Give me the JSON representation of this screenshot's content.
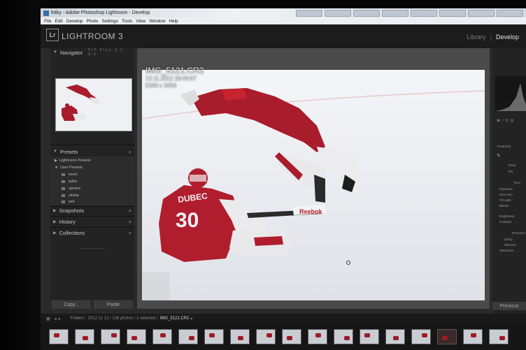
{
  "window": {
    "title": "fotky - Adobe Photoshop Lightroom - Develop"
  },
  "menu": [
    "File",
    "Edit",
    "Develop",
    "Photo",
    "Settings",
    "Tools",
    "View",
    "Window",
    "Help"
  ],
  "header": {
    "logo": "Lr",
    "app_name": "LIGHTROOM 3",
    "modules": [
      "Library",
      "Develop"
    ]
  },
  "left_panel": {
    "navigator": {
      "label": "Navigator",
      "options": "FIT FILL 1:1 3:1"
    },
    "presets": {
      "label": "Presets",
      "groups": [
        "Lightroom Presets",
        "User Presets"
      ],
      "items": [
        "new1",
        "tabla",
        "uprava",
        "vineta",
        "wol"
      ]
    },
    "snapshots": "Snapshots",
    "history": "History",
    "collections": "Collections",
    "copy_label": "Copy...",
    "paste_label": "Paste"
  },
  "photo": {
    "filename": "IMG_5121.CR2",
    "datetime": "12.11.2012 20:40:07",
    "dimensions": "5184 x 3456",
    "jersey_number": "30",
    "jersey_name": "DUBEC",
    "brand": "Reebok"
  },
  "right_panel": {
    "treatment": "Treatment",
    "tone_items": [
      "Temp",
      "Tint",
      "Tone",
      "Exposure",
      "Recovery",
      "Fill Light",
      "Blacks",
      "Brightness",
      "Contrast",
      "Presence",
      "Clarity",
      "Vibrance",
      "Saturation"
    ],
    "previous_label": "Previous"
  },
  "filmstrip": {
    "folder": "Folders : 2012 11 12 / 126 photos / 1 selected /",
    "selected_file": "IMG_5121.CR2",
    "thumb_count": 18
  },
  "colors": {
    "jersey_red": "#b01e2e",
    "ice": "#eceef2",
    "panel_bg": "#232323"
  }
}
